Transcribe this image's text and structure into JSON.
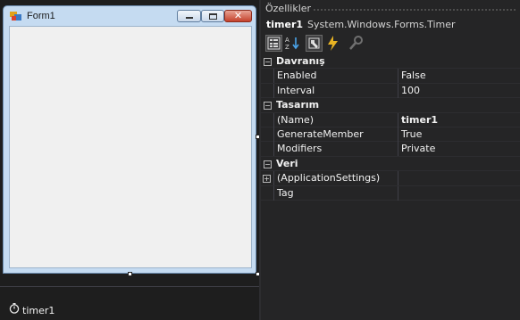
{
  "designer": {
    "form_title": "Form1",
    "close_glyph": "✕",
    "tray_component": "timer1",
    "icons": {
      "form": "form-icon",
      "minimize": "minimize-icon",
      "maximize": "maximize-icon",
      "close": "close-icon",
      "timer": "stopwatch-icon"
    }
  },
  "properties": {
    "panel_title": "Özellikler",
    "object_name": "timer1",
    "object_type": "System.Windows.Forms.Timer",
    "toolbar": [
      "categorized-icon",
      "alphabetical-icon",
      "properties-icon",
      "events-icon",
      "property-pages-icon"
    ],
    "expand_glyph_collapsed": "+",
    "expand_glyph_expanded": "−",
    "categories": [
      {
        "label": "Davranış",
        "rows": [
          {
            "name": "Enabled",
            "value": "False"
          },
          {
            "name": "Interval",
            "value": "100"
          }
        ]
      },
      {
        "label": "Tasarım",
        "rows": [
          {
            "name": "(Name)",
            "value": "timer1"
          },
          {
            "name": "GenerateMember",
            "value": "True"
          },
          {
            "name": "Modifiers",
            "value": "Private"
          }
        ]
      },
      {
        "label": "Veri",
        "rows": [
          {
            "name": "(ApplicationSettings)",
            "value": ""
          },
          {
            "name": "Tag",
            "value": ""
          }
        ]
      }
    ]
  },
  "colors": {
    "background": "#252526",
    "designer_bg": "#1e1e1e",
    "form_chrome": "#c5dbf1",
    "form_client": "#f0f0f0",
    "close_button": "#c4412b",
    "text": "#f1f1f1"
  }
}
